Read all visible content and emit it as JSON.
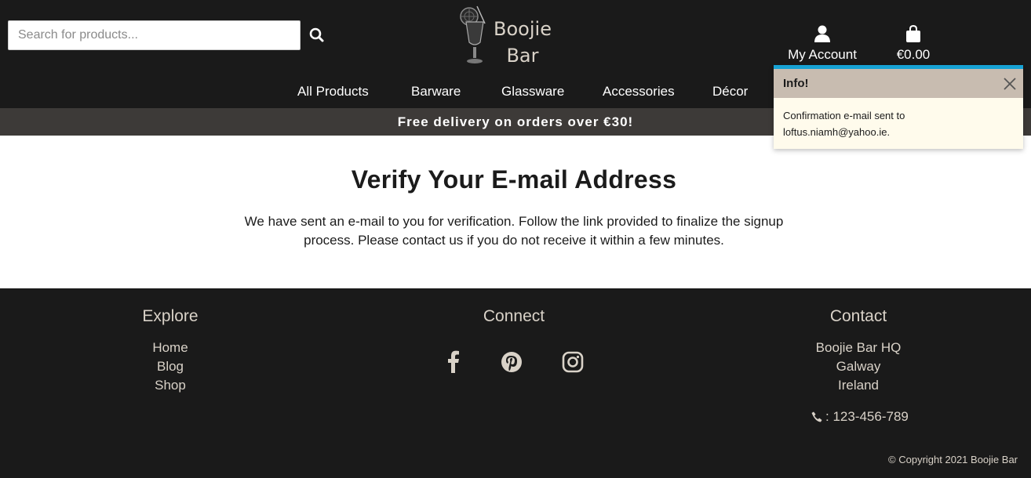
{
  "search": {
    "placeholder": "Search for products..."
  },
  "brand": {
    "line1": "Boojie",
    "line2": "Bar"
  },
  "header": {
    "account_label": "My Account",
    "cart_total": "€0.00"
  },
  "nav": [
    "All Products",
    "Barware",
    "Glassware",
    "Accessories",
    "Décor"
  ],
  "promo": "Free delivery on orders over €30!",
  "main": {
    "title": "Verify Your E-mail Address",
    "message": "We have sent an e-mail to you for verification. Follow the link provided to finalize the signup process. Please contact us if you do not receive it within a few minutes."
  },
  "toast": {
    "title": "Info!",
    "message": "Confirmation e-mail sent to loftus.niamh@yahoo.ie."
  },
  "footer": {
    "explore": {
      "title": "Explore",
      "links": [
        "Home",
        "Blog",
        "Shop"
      ]
    },
    "connect": {
      "title": "Connect",
      "icons": [
        "facebook-icon",
        "pinterest-icon",
        "instagram-icon"
      ]
    },
    "contact": {
      "title": "Contact",
      "lines": [
        "Boojie Bar HQ",
        "Galway",
        "Ireland"
      ],
      "phone": ": 123-456-789"
    },
    "copyright": "© Copyright 2021 Boojie Bar"
  },
  "colors": {
    "header_bg": "#1a1a1a",
    "promo_bg": "#3d3a38",
    "toast_accent": "#17a2d4",
    "toast_head": "#c8bcb0",
    "footer_text": "#d9d2c8"
  }
}
